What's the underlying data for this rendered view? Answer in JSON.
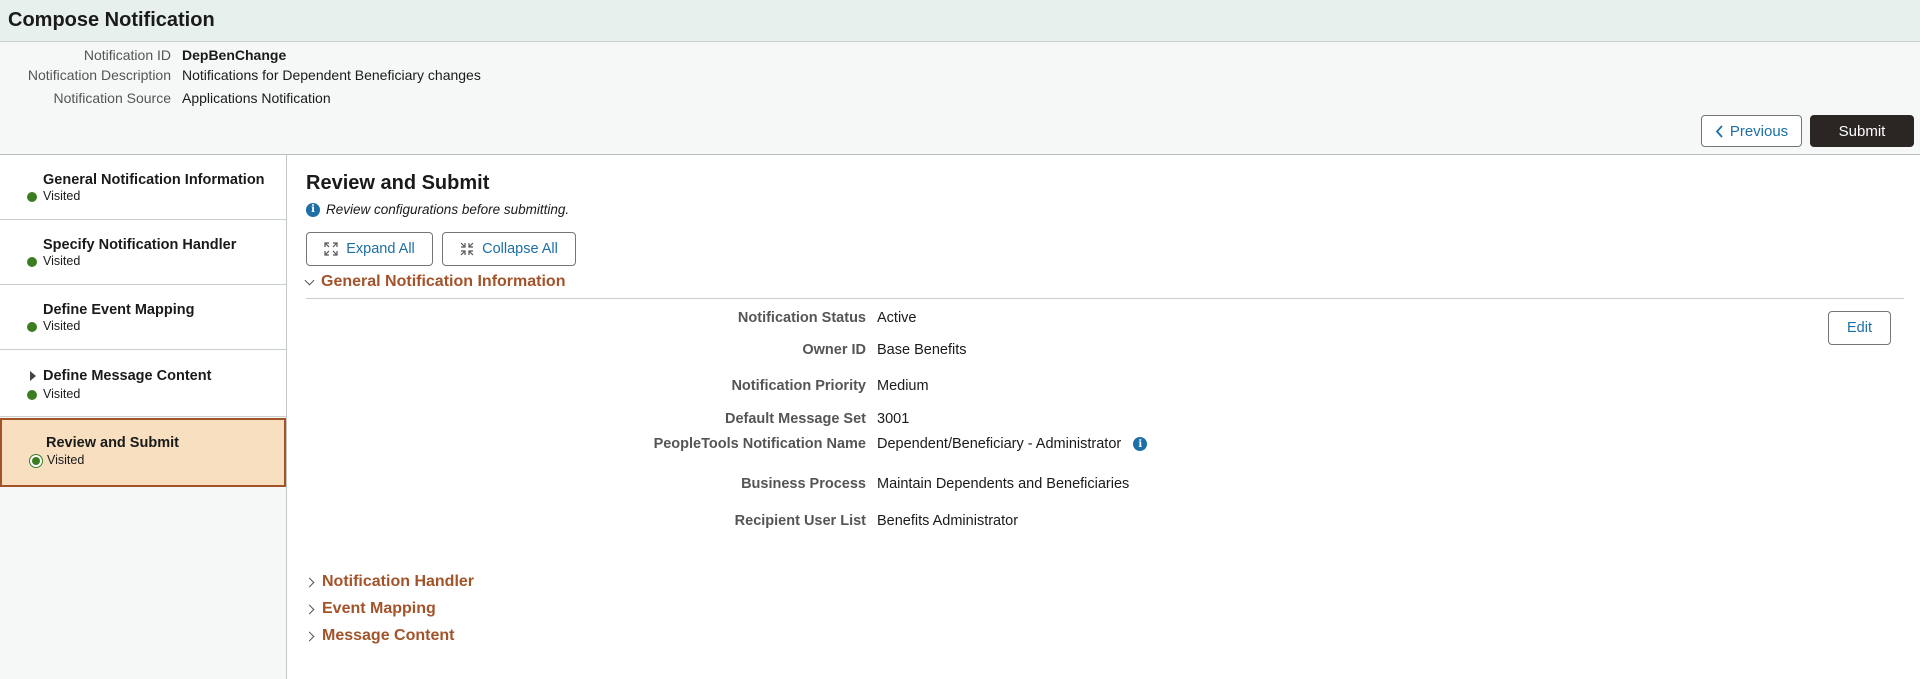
{
  "page_title": "Compose Notification",
  "header": {
    "fields": [
      {
        "label": "Notification ID",
        "value": "DepBenChange"
      },
      {
        "label": "Notification Description",
        "value": "Notifications for Dependent Beneficiary changes"
      },
      {
        "label": "Notification Source",
        "value": "Applications Notification"
      }
    ],
    "previous_label": "Previous",
    "submit_label": "Submit"
  },
  "sidebar": {
    "steps": [
      {
        "title": "General Notification Information",
        "status": "Visited"
      },
      {
        "title": "Specify Notification Handler",
        "status": "Visited"
      },
      {
        "title": "Define Event Mapping",
        "status": "Visited"
      },
      {
        "title": "Define Message Content",
        "status": "Visited"
      },
      {
        "title": "Review and Submit",
        "status": "Visited"
      }
    ]
  },
  "main": {
    "heading": "Review and Submit",
    "info_text": "Review configurations before submitting.",
    "expand_all_label": "Expand All",
    "collapse_all_label": "Collapse All",
    "general_section": {
      "title": "General Notification Information",
      "edit_label": "Edit",
      "fields": [
        {
          "label": "Notification Status",
          "value": "Active"
        },
        {
          "label": "Owner ID",
          "value": "Base Benefits"
        },
        {
          "label": "Notification Priority",
          "value": "Medium"
        },
        {
          "label": "Default Message Set",
          "value": "3001"
        },
        {
          "label": "PeopleTools Notification Name",
          "value": "Dependent/Beneficiary - Administrator"
        },
        {
          "label": "Business Process",
          "value": "Maintain Dependents and Beneficiaries"
        },
        {
          "label": "Recipient User List",
          "value": "Benefits Administrator"
        }
      ]
    },
    "collapsed_sections": [
      {
        "title": "Notification Handler"
      },
      {
        "title": "Event Mapping"
      },
      {
        "title": "Message Content"
      }
    ]
  },
  "colors": {
    "accent": "#a3532a",
    "link": "#1d6fa5",
    "visited_dot": "#3c7d22",
    "active_step_bg": "#f7dfc0",
    "submit_bg": "#2b2523"
  }
}
